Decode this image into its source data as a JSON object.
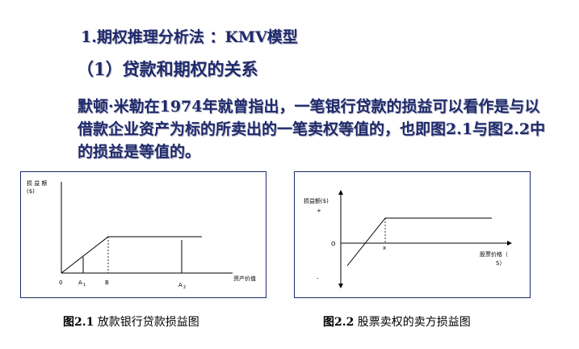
{
  "heading1": "1.期权推理分析法 ：KMV模型",
  "heading2": "（1）贷款和期权的关系",
  "paragraph": "默顿·米勒在1974年就曾指出，一笔银行贷款的损益可以看作是与以借款企业资产为标的所卖出的一笔卖权等值的，也即图2.1与图2.2中的损益是等值的。",
  "figure1": {
    "ylabel_line1": "损 益 额",
    "ylabel_line2": "($)",
    "xlabel": "资产价值",
    "origin": "0",
    "tick_a1": "A",
    "tick_a1_sub": "1",
    "tick_b": "B",
    "tick_a2": "A",
    "tick_a2_sub": "2",
    "caption_num": "图2.1",
    "caption_text": " 放款银行贷款损益图"
  },
  "figure2": {
    "ylabel": "损益额($)",
    "plus": "+",
    "minus": "-",
    "origin": "O",
    "tick_x": "x",
    "xlabel_line1": "股票价格（",
    "xlabel_line2": "S）",
    "caption_num": "图2.2",
    "caption_text": " 股票卖权的卖方损益图"
  }
}
